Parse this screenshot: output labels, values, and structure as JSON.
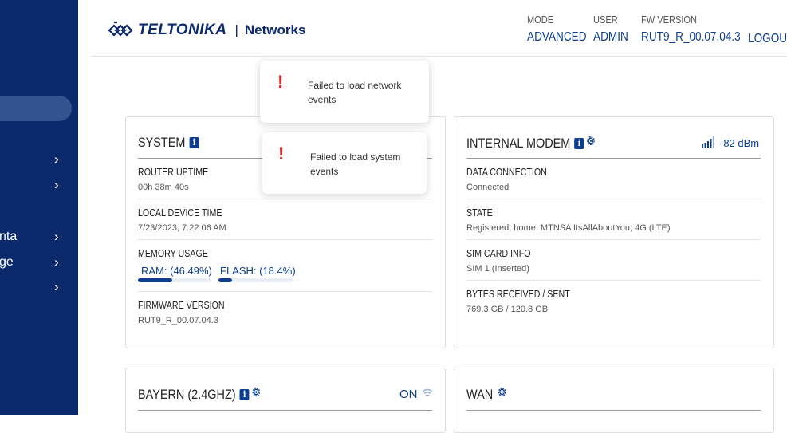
{
  "sidebar": {
    "items": [
      {
        "label": "",
        "chevron": "›"
      },
      {
        "label": "",
        "chevron": "›"
      },
      {
        "label": "nta",
        "chevron": "›"
      },
      {
        "label": "ge",
        "chevron": "›"
      },
      {
        "label": "",
        "chevron": "›"
      }
    ]
  },
  "header": {
    "brand": "TELTONIKA",
    "separator": "|",
    "product": "Networks",
    "mode_label": "MODE",
    "mode_value": "ADVANCED",
    "user_label": "USER",
    "user_value": "ADMIN",
    "fw_label": "FW VERSION",
    "fw_value": "RUT9_R_00.07.04.3",
    "logout": "LOGOUT"
  },
  "toasts": [
    {
      "icon": "!",
      "message": "Failed to load network events"
    },
    {
      "icon": "!",
      "message": "Failed to load system events"
    }
  ],
  "system": {
    "title": "SYSTEM",
    "info_icon": "i",
    "uptime_label": "ROUTER UPTIME",
    "uptime_value": "00h 38m 40s",
    "time_label": "LOCAL DEVICE TIME",
    "time_value": "7/23/2023, 7:22:06 AM",
    "memory_label": "MEMORY USAGE",
    "ram_label": "RAM: (46.49%)",
    "ram_fraction": 0.4649,
    "flash_label": "FLASH: (18.4%)",
    "flash_fraction": 0.184,
    "fw_label": "FIRMWARE VERSION",
    "fw_value": "RUT9_R_00.07.04.3"
  },
  "modem": {
    "title": "INTERNAL MODEM",
    "info_icon": "i",
    "signal": "-82 dBm",
    "data_label": "DATA CONNECTION",
    "data_value": "Connected",
    "state_label": "STATE",
    "state_value": "Registered, home; MTNSA ItsAllAboutYou; 4G (LTE)",
    "sim_label": "SIM CARD INFO",
    "sim_value": "SIM 1 (Inserted)",
    "bytes_label": "BYTES RECEIVED / SENT",
    "bytes_value": "769.3 GB / 120.8 GB"
  },
  "wifi": {
    "title": "BAYERN (2.4GHZ)",
    "info_icon": "i",
    "status": "ON"
  },
  "wan": {
    "title": "WAN"
  },
  "colors": {
    "sidebar": "#0c2a6b",
    "accent": "#0c3d8f",
    "error": "#dd2222"
  }
}
